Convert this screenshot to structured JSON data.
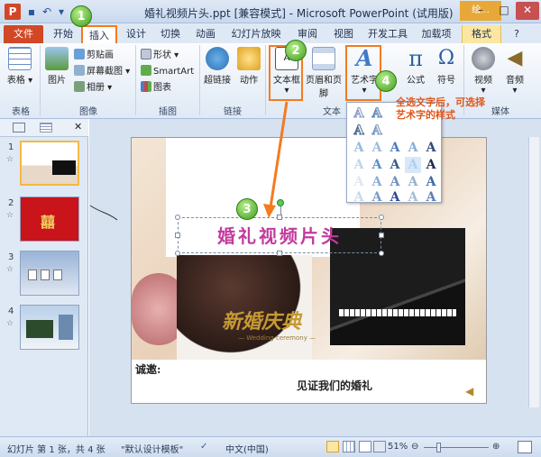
{
  "titlebar": {
    "app_icon": "P",
    "title": "婚礼视频片头.ppt [兼容模式] - Microsoft PowerPoint (试用版)",
    "context_label": "绘..."
  },
  "tabs": [
    "文件",
    "开始",
    "插入",
    "设计",
    "切换",
    "动画",
    "幻灯片放映",
    "审阅",
    "视图",
    "开发工具",
    "加载项",
    "格式"
  ],
  "ribbon": {
    "table": "表格",
    "picture": "图片",
    "clipart": "剪贴画",
    "screenshot": "屏幕截图",
    "album": "相册",
    "shapes": "形状",
    "smartart": "SmartArt",
    "chart": "图表",
    "hyperlink": "超链接",
    "action": "动作",
    "textbox": "文本框",
    "header_footer": "页眉和页脚",
    "wordart": "艺术字",
    "equation": "公式",
    "symbol": "符号",
    "video": "视频",
    "audio": "音频",
    "groups": {
      "table": "表格",
      "images": "图像",
      "illustrations": "插图",
      "links": "链接",
      "text": "文本",
      "media": "媒体"
    }
  },
  "callouts": {
    "b1": "1",
    "b2": "2",
    "b3": "3",
    "b4": "4",
    "note": "全选文字后，可选择艺术字的样式"
  },
  "thumbnails": [
    "1",
    "2",
    "3",
    "4"
  ],
  "thumb_star": "☆",
  "slide": {
    "title_text": "婚礼视频片头",
    "brand_text": "新婚庆典",
    "brand_sub": "— Wedding ceremony —",
    "invite": "诚邀:",
    "line": "见证我们的婚礼"
  },
  "statusbar": {
    "slide_info": "幻灯片 第 1 张，共 4 张",
    "theme": "\"默认设计模板\"",
    "language": "中文(中国)",
    "zoom": "51%"
  },
  "colors": {
    "accent": "#f47b20",
    "file_tab": "#d24726",
    "callout_text": "#e0561b",
    "wordart_title": "#c23a9c"
  }
}
